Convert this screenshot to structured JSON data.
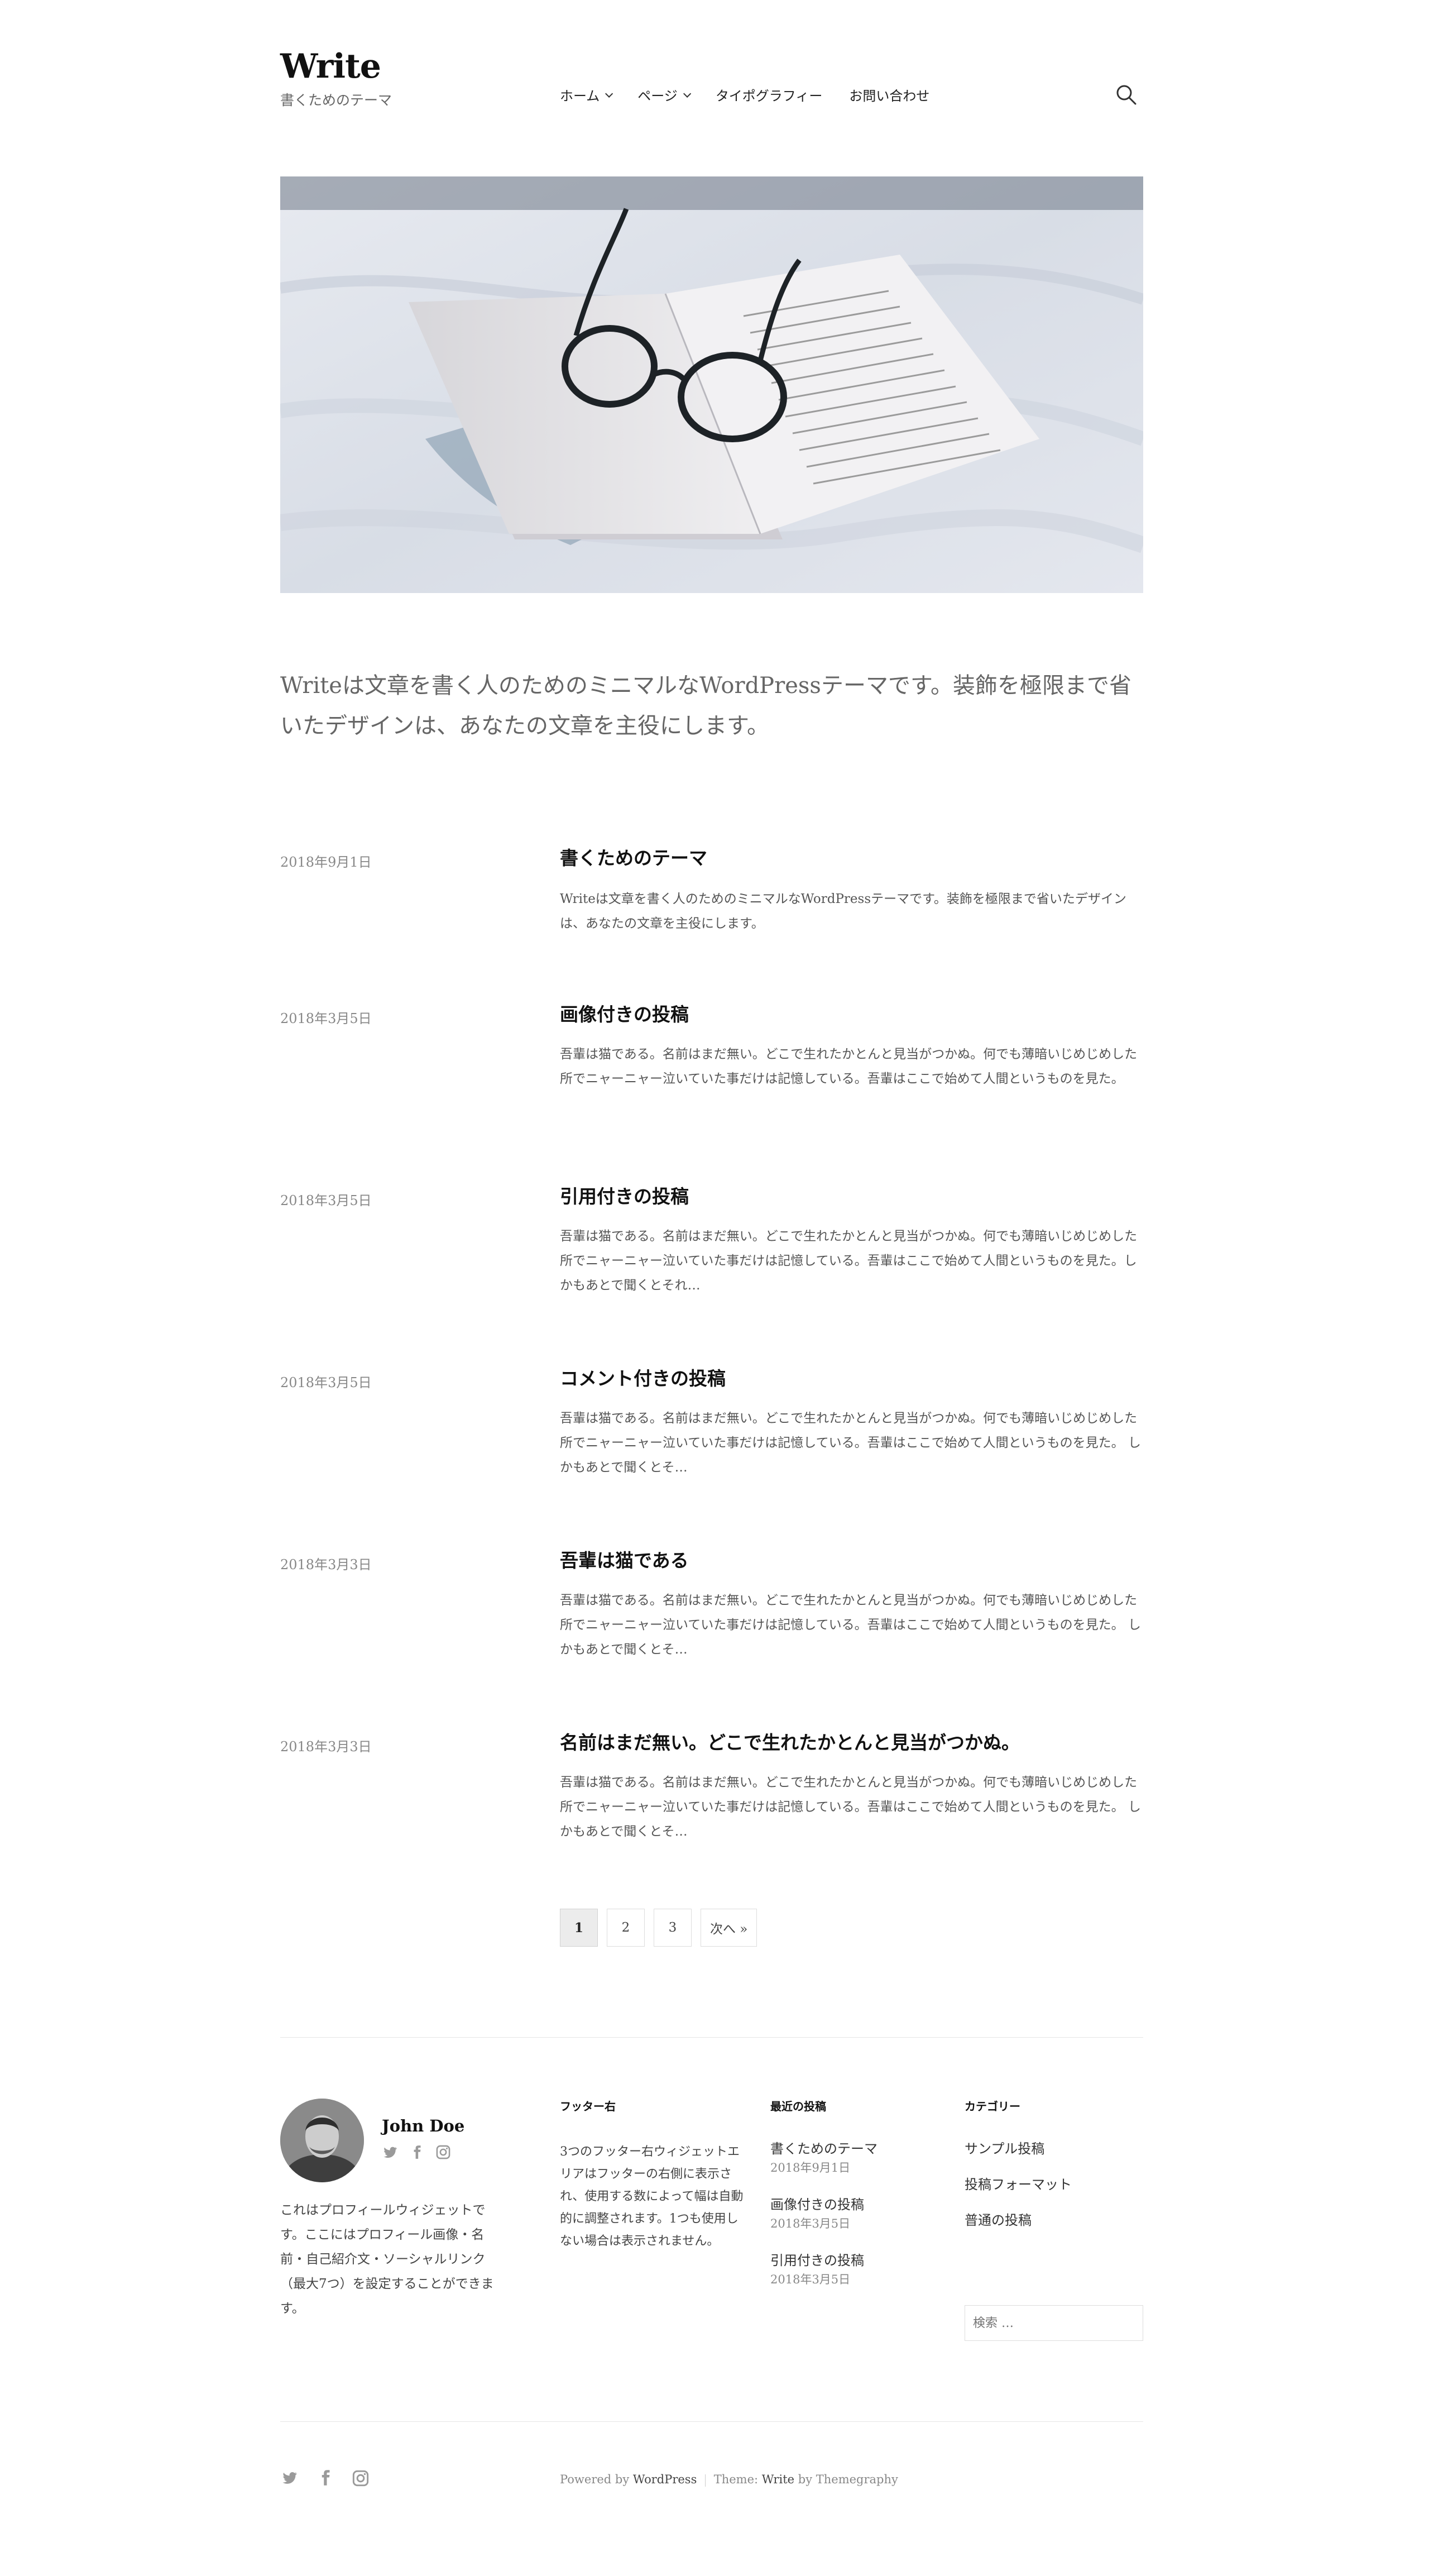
{
  "site": {
    "title": "Write",
    "description": "書くためのテーマ"
  },
  "nav": {
    "items": [
      {
        "label": "ホーム",
        "has_submenu": true
      },
      {
        "label": "ページ",
        "has_submenu": true
      },
      {
        "label": "タイポグラフィー",
        "has_submenu": false
      },
      {
        "label": "お問い合わせ",
        "has_submenu": false
      }
    ],
    "search_icon": "search-icon"
  },
  "hero": {
    "subject": "open-book-with-eyeglasses-on-bedsheet"
  },
  "intro": "Writeは文章を書く人のためのミニマルなWordPressテーマです。装飾を極限まで省いたデザインは、あなたの文章を主役にします。",
  "posts": [
    {
      "date": "2018年9月1日",
      "title": "書くためのテーマ",
      "excerpt": "Writeは文章を書く人のためのミニマルなWordPressテーマです。装飾を極限まで省いたデザインは、あなたの文章を主役にします。"
    },
    {
      "date": "2018年3月5日",
      "title": "画像付きの投稿",
      "excerpt": "吾輩は猫である。名前はまだ無い。どこで生れたかとんと見当がつかぬ。何でも薄暗いじめじめした所でニャーニャー泣いていた事だけは記憶している。吾輩はここで始めて人間というものを見た。"
    },
    {
      "date": "2018年3月5日",
      "title": "引用付きの投稿",
      "excerpt": "吾輩は猫である。名前はまだ無い。どこで生れたかとんと見当がつかぬ。何でも薄暗いじめじめした所でニャーニャー泣いていた事だけは記憶している。吾輩はここで始めて人間というものを見た。しかもあとで聞くとそれ…"
    },
    {
      "date": "2018年3月5日",
      "title": "コメント付きの投稿",
      "excerpt": "吾輩は猫である。名前はまだ無い。どこで生れたかとんと見当がつかぬ。何でも薄暗いじめじめした所でニャーニャー泣いていた事だけは記憶している。吾輩はここで始めて人間というものを見た。 しかもあとで聞くとそ…"
    },
    {
      "date": "2018年3月3日",
      "title": "吾輩は猫である",
      "excerpt": "吾輩は猫である。名前はまだ無い。どこで生れたかとんと見当がつかぬ。何でも薄暗いじめじめした所でニャーニャー泣いていた事だけは記憶している。吾輩はここで始めて人間というものを見た。 しかもあとで聞くとそ…"
    },
    {
      "date": "2018年3月3日",
      "title": "名前はまだ無い。どこで生れたかとんと見当がつかぬ。",
      "excerpt": "吾輩は猫である。名前はまだ無い。どこで生れたかとんと見当がつかぬ。何でも薄暗いじめじめした所でニャーニャー泣いていた事だけは記憶している。吾輩はここで始めて人間というものを見た。 しかもあとで聞くとそ…"
    }
  ],
  "pagination": {
    "current": "1",
    "pages": [
      "2",
      "3"
    ],
    "next": "次へ »"
  },
  "footer": {
    "profile": {
      "name": "John Doe",
      "social_icons": [
        "twitter-icon",
        "facebook-icon",
        "instagram-icon"
      ],
      "text": "これはプロフィールウィジェットです。ここにはプロフィール画像・名前・自己紹介文・ソーシャルリンク（最大7つ）を設定することができます。"
    },
    "footer_right": {
      "title": "フッター右",
      "text": "3つのフッター右ウィジェットエリアはフッターの右側に表示され、使用する数によって幅は自動的に調整されます。1つも使用しない場合は表示されません。"
    },
    "recent_posts": {
      "title": "最近の投稿",
      "items": [
        {
          "title": "書くためのテーマ",
          "date": "2018年9月1日"
        },
        {
          "title": "画像付きの投稿",
          "date": "2018年3月5日"
        },
        {
          "title": "引用付きの投稿",
          "date": "2018年3月5日"
        }
      ]
    },
    "categories": {
      "title": "カテゴリー",
      "items": [
        "サンプル投稿",
        "投稿フォーマット",
        "普通の投稿"
      ]
    },
    "search_placeholder": "検索 …"
  },
  "bottom": {
    "social_icons": [
      "twitter-icon",
      "facebook-icon",
      "instagram-icon"
    ],
    "powered_by": "Powered by",
    "wordpress": "WordPress",
    "theme_label": "Theme:",
    "theme_name": "Write",
    "by": "by Themegraphy"
  }
}
